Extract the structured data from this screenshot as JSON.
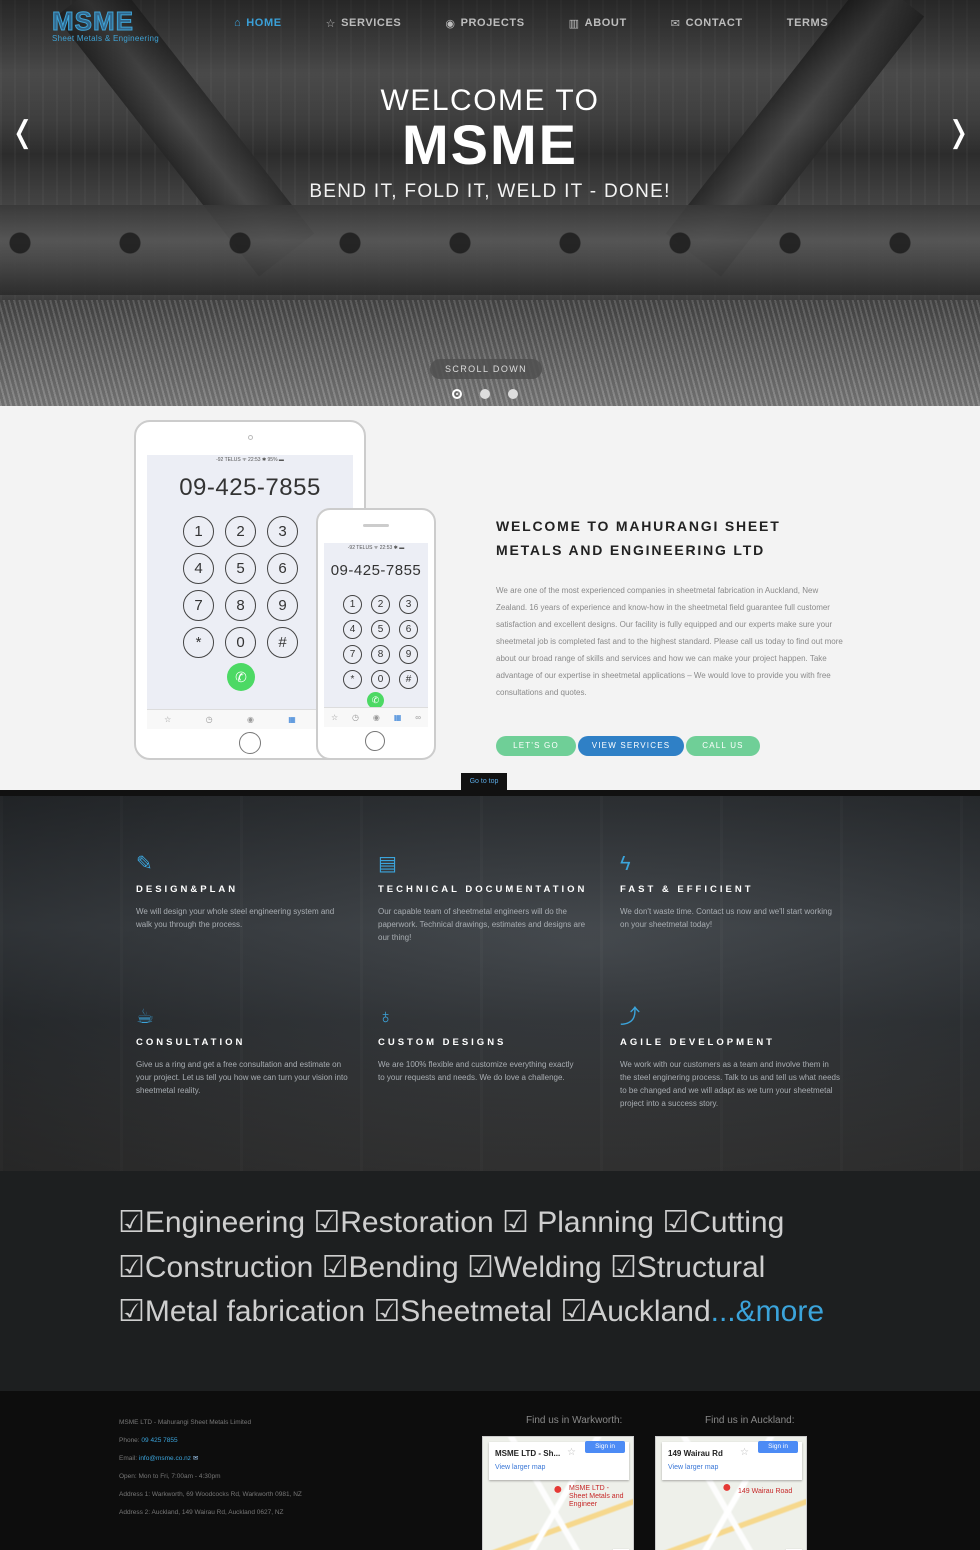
{
  "header": {
    "logo": {
      "brand": "MSME",
      "tagline": "Sheet Metals & Engineering"
    },
    "nav": [
      {
        "label": "HOME",
        "icon": "home-icon",
        "glyph": "⌂",
        "active": true
      },
      {
        "label": "SERVICES",
        "icon": "star-icon",
        "glyph": "☆",
        "active": false
      },
      {
        "label": "PROJECTS",
        "icon": "camera-icon",
        "glyph": "◉",
        "active": false
      },
      {
        "label": "ABOUT",
        "icon": "book-icon",
        "glyph": "▥",
        "active": false
      },
      {
        "label": "CONTACT",
        "icon": "envelope-icon",
        "glyph": "✉",
        "active": false
      },
      {
        "label": "TERMS",
        "icon": "",
        "glyph": "",
        "active": false
      }
    ],
    "accent_color": "#3aa0d8"
  },
  "hero": {
    "welcome_to": "WELCOME TO",
    "brand": "MSME",
    "tagline": "BEND IT, FOLD IT, WELD IT - DONE!",
    "prev_arrow": "❬",
    "next_arrow": "❭",
    "scroll_label": "SCROLL DOWN",
    "slides": 3,
    "active_slide": 1
  },
  "about": {
    "tablet": {
      "status": "-92 TELUS ᯤ     22:53     ✱ 95% ▬",
      "number": "09-425-7855",
      "keys": [
        "1",
        "2",
        "3",
        "4",
        "5",
        "6",
        "7",
        "8",
        "9",
        "*",
        "0",
        "#"
      ],
      "call_glyph": "✆",
      "tabs": [
        "☆",
        "◷",
        "◉",
        "▦",
        "∞"
      ]
    },
    "phone": {
      "status": "-92 TELUS ᯤ   22:53   ✱ ▬",
      "number": "09-425-7855",
      "keys": [
        "1",
        "2",
        "3",
        "4",
        "5",
        "6",
        "7",
        "8",
        "9",
        "*",
        "0",
        "#"
      ],
      "call_glyph": "✆",
      "tabs": [
        "☆",
        "◷",
        "◉",
        "▦",
        "∞"
      ]
    },
    "title": "WELCOME TO MAHURANGI SHEET METALS AND ENGINEERING LTD",
    "body": "We are one of the most experienced companies in sheetmetal fabrication in Auckland, New Zealand. 16 years of experience and know-how in the sheetmetal field guarantee full customer satisfaction and excellent designs. Our facility is fully equipped and our experts make sure your sheetmetal job is completed fast and to the highest standard. Please call us today to find out more about our broad range of skills and services and how we can make your project happen. Take advantage of our expertise in sheetmetal applications – We would love to provide you with free consultations and quotes.",
    "buttons": {
      "lets_go": "LET'S GO",
      "view_services": "VIEW SERVICES",
      "call_us": "CALL US"
    },
    "go_top": "Go to top"
  },
  "features": [
    {
      "icon": "design-tools-icon",
      "glyph": "✎",
      "title": "DESIGN&PLAN",
      "text": "We will design your whole steel engineering system and walk you through the process."
    },
    {
      "icon": "document-icon",
      "glyph": "▤",
      "title": "TECHNICAL DOCUMENTATION",
      "text": "Our capable team of sheetmetal engineers will do the paperwork. Technical drawings, estimates and designs are our thing!"
    },
    {
      "icon": "lightning-icon",
      "glyph": "ϟ",
      "title": "FAST & EFFICIENT",
      "text": "We don't waste time. Contact us now and we'll start working on your sheetmetal today!"
    },
    {
      "icon": "coffee-cup-icon",
      "glyph": "☕",
      "title": "CONSULTATION",
      "text": "Give us a ring and get a free consultation and estimate on your project. Let us tell you how we can turn your vision into sheetmetal reality."
    },
    {
      "icon": "lightbulb-icon",
      "glyph": "♁",
      "title": "CUSTOM DESIGNS",
      "text": "We are 100% flexible and customize everything exactly to your requests and needs. We do love a challenge."
    },
    {
      "icon": "graph-icon",
      "glyph": "⤴",
      "title": "AGILE DEVELOPMENT",
      "text": "We work with our customers as a team and involve them in the steel enginering process. Talk to us and tell us what needs to be changed and we will adapt as we turn your sheetmetal project into a success story."
    }
  ],
  "keywords": {
    "line1": "☑Engineering ☑Restoration ☑ Planning ☑Cutting",
    "line2": "☑Construction ☑Bending ☑Welding ☑Structural",
    "line3": "☑Metal fabrication ☑Sheetmetal ☑Auckland",
    "more": "...&more"
  },
  "footer": {
    "company": "MSME LTD - Mahurangi Sheet Metals Limited",
    "phone_label": "Phone: ",
    "phone": "09 425 7855",
    "email_label": "Email: ",
    "email": "info@msme.co.nz",
    "hours": "Open: Mon to Fri, 7:00am - 4:30pm",
    "address1": "Address 1: Warkworth, 69 Woodcocks Rd, Warkworth 0981, NZ",
    "address2": "Address 2: Auckland, 149 Wairau Rd, Auckland 0627, NZ",
    "map1": {
      "label": "Find us in Warkworth:",
      "name": "MSME LTD - Sh...",
      "view_larger": "View larger map",
      "sign_in": "Sign in",
      "place": "MSME LTD - Sheet Metals and Engineer"
    },
    "map2": {
      "label": "Find us in Auckland:",
      "name": "149 Wairau Rd",
      "view_larger": "View larger map",
      "sign_in": "Sign in",
      "place": "149 Wairau Road"
    }
  }
}
